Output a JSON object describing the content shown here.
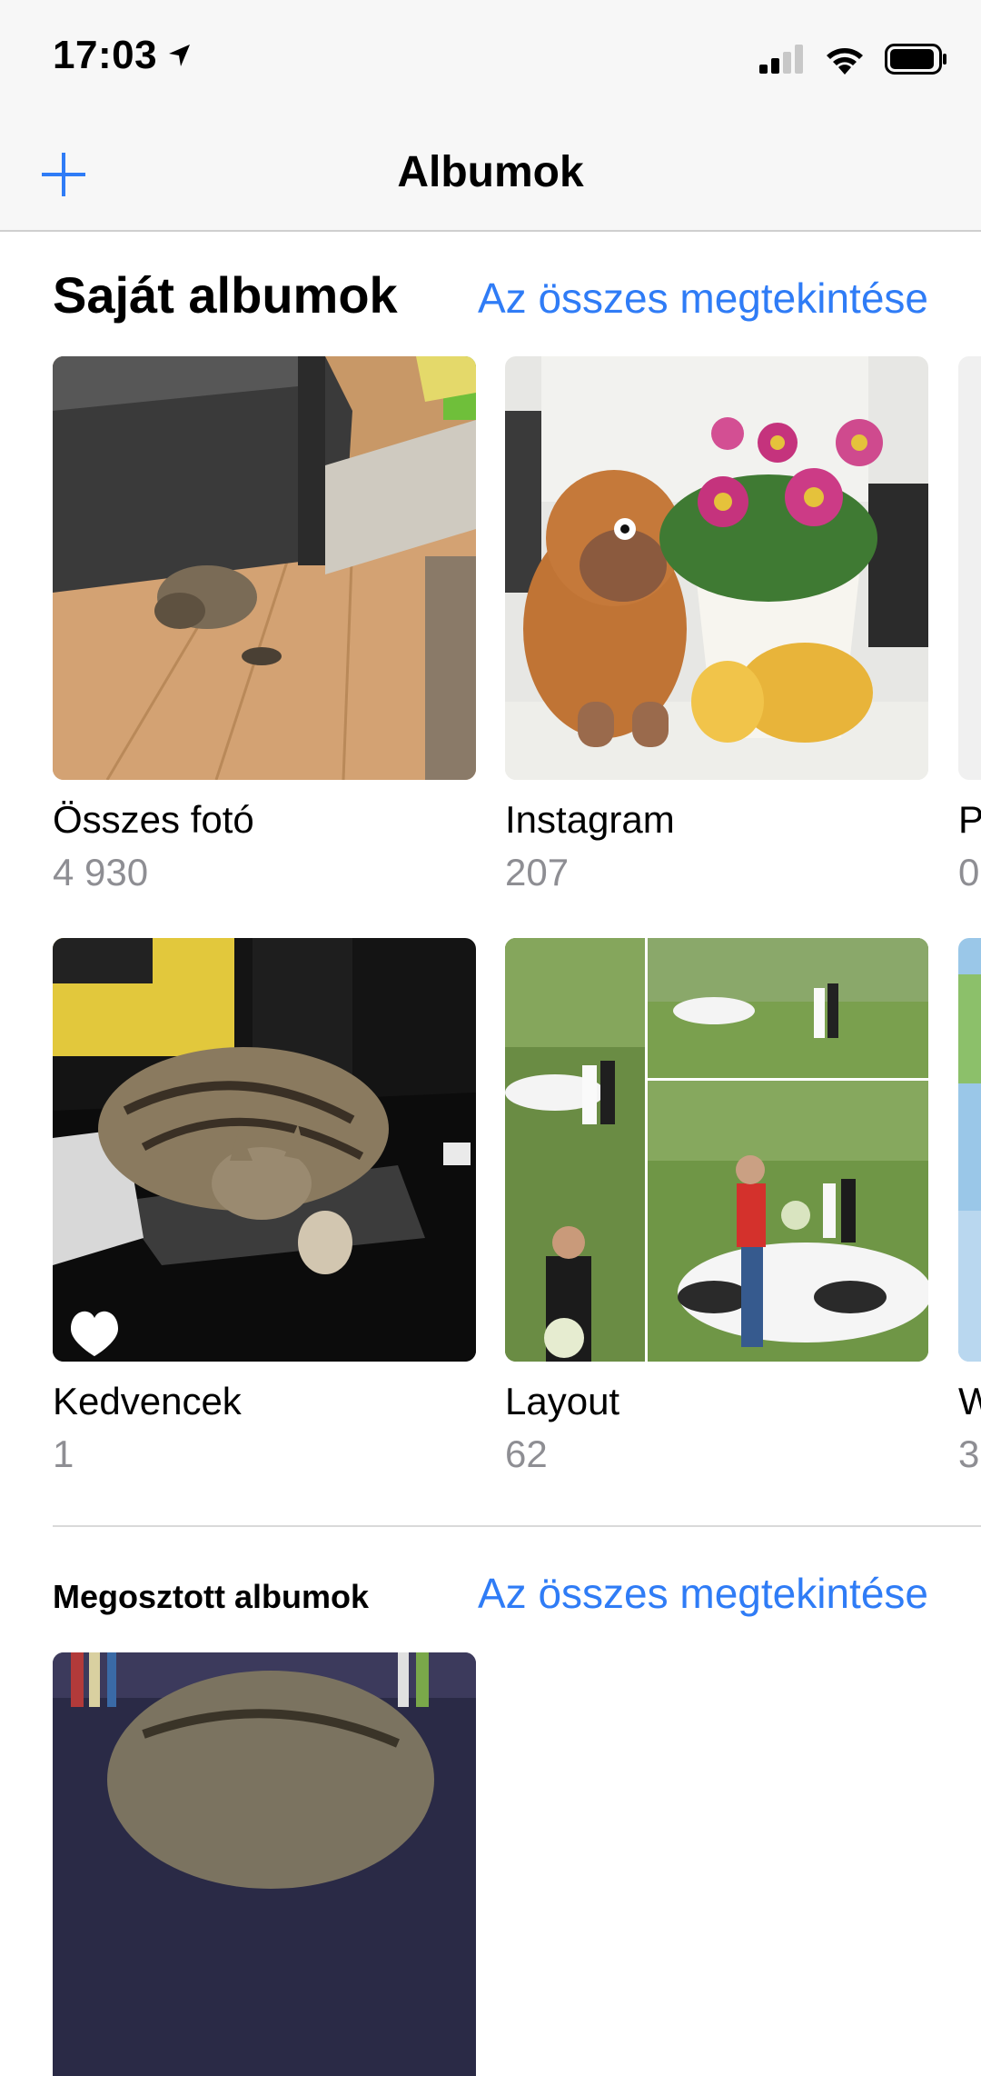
{
  "status_bar": {
    "time": "17:03",
    "icons": [
      "location-arrow-icon",
      "cellular-signal-icon",
      "wifi-icon",
      "battery-icon"
    ]
  },
  "nav": {
    "title": "Albumok",
    "add_icon": "plus-icon"
  },
  "my_albums": {
    "title": "Saját albumok",
    "see_all": "Az összes megtekintése",
    "albums": [
      {
        "name": "Összes fotó",
        "count": "4 930"
      },
      {
        "name": "Instagram",
        "count": "207"
      },
      {
        "name": "P",
        "count": "0"
      },
      {
        "name": "Kedvencek",
        "count": "1"
      },
      {
        "name": "Layout",
        "count": "62"
      },
      {
        "name": "W",
        "count": "3"
      }
    ]
  },
  "shared_albums": {
    "title": "Megosztott albumok",
    "see_all": "Az összes megtekintése"
  },
  "colors": {
    "accent": "#2f7cf6",
    "secondary_text": "#8e8e93",
    "bar_background": "#f7f7f7"
  }
}
